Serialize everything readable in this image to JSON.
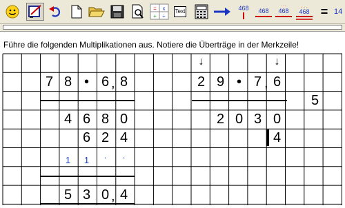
{
  "toolbar": {
    "buttons": [
      {
        "name": "smiley-icon"
      },
      {
        "name": "edit-sheet-icon"
      },
      {
        "name": "undo-icon"
      },
      {
        "name": "new-page-icon"
      },
      {
        "name": "open-folder-icon"
      },
      {
        "name": "save-icon"
      },
      {
        "name": "print-preview-icon"
      },
      {
        "name": "operators-icon"
      },
      {
        "name": "text-tool-icon",
        "label": "Text"
      },
      {
        "name": "calculator-icon"
      },
      {
        "name": "arrow-right-icon"
      },
      {
        "name": "format-468-a-icon",
        "label": "468"
      },
      {
        "name": "format-468-b-icon",
        "label": "468"
      },
      {
        "name": "format-468-c-icon",
        "label": "468"
      },
      {
        "name": "format-468-d-icon",
        "label": "468"
      },
      {
        "name": "equals-icon",
        "label": "="
      },
      {
        "name": "partial-14-icon",
        "label": "14"
      }
    ]
  },
  "instruction": "Führe die folgenden Multiplikationen aus. Notiere die Überträge in der Merkzeile!",
  "left_problem": {
    "row1": [
      "7",
      "8",
      "•",
      "6",
      "8"
    ],
    "row2": [
      "4",
      "6",
      "8",
      "0"
    ],
    "row3": [
      "6",
      "2",
      "4"
    ],
    "carries": [
      "1",
      "1",
      "·",
      "·"
    ],
    "result": [
      "5",
      "3",
      "0",
      "4"
    ],
    "comma": ","
  },
  "right_problem": {
    "row1": [
      "2",
      "9",
      "•",
      "7",
      "6"
    ],
    "row2": [
      "2",
      "0",
      "3",
      "0"
    ],
    "row3": [
      "4"
    ],
    "side_digit": "5",
    "comma": ",",
    "arrow1": "↓",
    "arrow2": "↓"
  },
  "colors": {
    "carry": "#1a3fc4",
    "toolbar": "#ece9d8",
    "grid": "#000000"
  }
}
